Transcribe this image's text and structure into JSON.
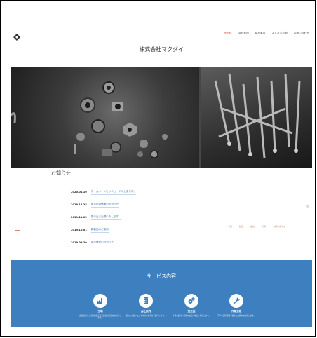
{
  "header": {
    "company_name": "株式会社マクダイ",
    "nav": [
      "HOME",
      "会社案内",
      "製品案内",
      "よくある質問",
      "お問い合わせ"
    ]
  },
  "hero": {
    "left_image_label": "metal-parts-photo",
    "right_image_label": "shafts-photo"
  },
  "news": {
    "title": "お知らせ",
    "items": [
      {
        "date": "2020.01.10",
        "text": "ホームページをリニューアルしました。"
      },
      {
        "date": "2019.12.25",
        "text": "年末年始休業のお知らせ"
      },
      {
        "date": "2019.11.05",
        "text": "展示会に出展いたします。"
      },
      {
        "date": "2019.10.01",
        "text": "新製品のご案内"
      },
      {
        "date": "2019.09.20",
        "text": "夏季休業のお知らせ"
      }
    ],
    "side_links": [
      "一覧",
      "製品",
      "会社",
      "採用",
      "お問い合わせ"
    ]
  },
  "services": {
    "title": "サービス内容",
    "items": [
      {
        "label": "工場",
        "icon": "factory-icon",
        "desc": "最新設備による精密加工で高品質な製品をお届けします。"
      },
      {
        "label": "会社案内",
        "icon": "building-icon",
        "desc": "私たちの想いとこれまでの歩みをご紹介します。"
      },
      {
        "label": "加工品",
        "icon": "gears-icon",
        "desc": "多様な素材・形状の加工に幅広く対応します。"
      },
      {
        "label": "作業工程",
        "icon": "wrench-icon",
        "desc": "丁寧な工程管理で確かな品質をお約束します。"
      }
    ]
  },
  "colors": {
    "accent": "#d33a2c",
    "services_bg": "#3d7fbf",
    "link": "#3b6fb5"
  }
}
